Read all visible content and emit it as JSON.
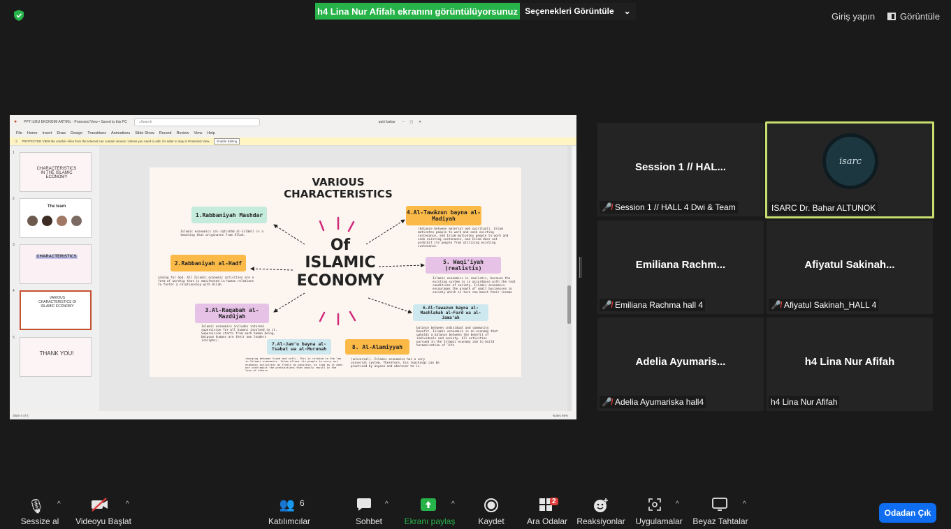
{
  "top_bar": {
    "share_banner": "h4 Lina Nur Afifah ekranını görüntülüyorsunuz",
    "view_options": "Seçenekleri Görüntüle",
    "sign_in": "Giriş yapın",
    "view": "Görüntüle",
    "shield_color": "#28b34a"
  },
  "ppt": {
    "title": "PPT ILMU EKONOMI ARTIKIL - Protected View • Saved to this PC",
    "search_placeholder": "Search",
    "user": "putri bahar",
    "menu": [
      "File",
      "Home",
      "Insert",
      "Draw",
      "Design",
      "Transitions",
      "Animations",
      "Slide Show",
      "Record",
      "Review",
      "View",
      "Help"
    ],
    "protected_view": "PROTECTED VIEW  Be careful—files from the Internet can contain viruses. Unless you need to edit, it's safer to stay in Protected View.",
    "enable_editing": "Enable Editing",
    "status_left": "Slide 4 of 5",
    "status_right": "Notes   66%",
    "thumbnails": [
      {
        "num": "1",
        "text": "CHARACTERISTICS IN THE ISLAMIC ECONOMY"
      },
      {
        "num": "2",
        "text": "The team"
      },
      {
        "num": "3",
        "text": "CHARACTERISTICS"
      },
      {
        "num": "4",
        "text": "VARIOUS CHARACTERISTICS Of ISLAMIC ECONOMY"
      },
      {
        "num": "5",
        "text": "THANK YOU!"
      }
    ],
    "slide": {
      "title": "VARIOUS CHARACTERISTICS",
      "center_of": "Of",
      "center_islamic": "ISLAMIC",
      "center_economy": "ECONOMY",
      "boxes": [
        {
          "label": "1.Rabbaniyah Mashdar",
          "desc": "Islamic economics (al-iqtishâd al-Islâmî) is a teaching that originates from Allah."
        },
        {
          "label": "2.Rabbaniyah al-Hadf",
          "desc": "aiming for God. All Islamic economic activities are a form of worship that is manifested in human relations to foster a relationship with Allah."
        },
        {
          "label": "3.Al-Raqabah al-Mazdûjah",
          "desc": "Islamic economics includes internal supervision for all humans involved in it. Supervision starts from each human being, because humans are their own leaders (caliphs)."
        },
        {
          "label": "4.Al-Tawâzun bayna al-Madiyah",
          "desc": "(balance between material and spiritual). Islam motivates people to work and seek existing sustenance, and Islam motivates people to work and seek existing sustenance, and Islam does not prohibit its people from utilizing existing sustenance."
        },
        {
          "label": "5. Waqi'iyah (realistis)",
          "desc": "Islamic economics is realistic, because the existing system is in accordance with the real conditions of society. Islamic economics encourages the growth of small businesses in society which in turn can boost their income"
        },
        {
          "label": "6.Al-Tawazun bayna al-Mashlahah al-Fard wa al-Jama'ah",
          "desc": "balance between individual and community benefit. Islamic economics is an economy that upholds a balance between the benefit of individuals and society. All activities pursued in the Islamic economy aim to build harmonization of life"
        },
        {
          "label": "7.Al-Jam'u bayna al-Tsabat wa al-Murunah",
          "desc": "(merging between fixed and soft). This is related to the law in Islamic economics. Islam allows its people to carry out economic activities as freely as possible, as long as it does not contradict the prohibitions that mostly result in the loss of others"
        },
        {
          "label": "8. Al-Alamiyyah",
          "desc": "(universal). Islamic economics has a very universal system. Therefore, his teachings can be practiced by anyone and wherever he is."
        }
      ]
    }
  },
  "participants": [
    {
      "display": "Session 1 // HAL...",
      "label": "Session 1 // HALL 4 Dwi & Team",
      "muted": true
    },
    {
      "display": "",
      "label": "ISARC Dr. Bahar ALTUNOK",
      "muted": false,
      "logo_text": "isarc"
    },
    {
      "display": "Emiliana  Rachm...",
      "label": "Emiliana Rachma hall 4",
      "muted": true
    },
    {
      "display": "Afiyatul  Sakinah...",
      "label": "Afiyatul Sakinah_HALL 4",
      "muted": true
    },
    {
      "display": "Adelia  Ayumaris...",
      "label": "Adelia Ayumariska hall4",
      "muted": true
    },
    {
      "display": "h4 Lina Nur Afifah",
      "label": "h4 Lina Nur Afifah",
      "muted": false
    }
  ],
  "toolbar": {
    "mute": "Sessize al",
    "video": "Videoyu Başlat",
    "participants": "Katılımcılar",
    "participants_count": "6",
    "chat": "Sohbet",
    "share": "Ekranı paylaş",
    "record": "Kaydet",
    "breakout": "Ara Odalar",
    "breakout_badge": "2",
    "reactions": "Reaksiyonlar",
    "apps": "Uygulamalar",
    "whiteboard": "Beyaz Tahtalar",
    "leave": "Odadan Çık",
    "share_color": "#28b34a",
    "leave_color": "#0e6df1"
  }
}
